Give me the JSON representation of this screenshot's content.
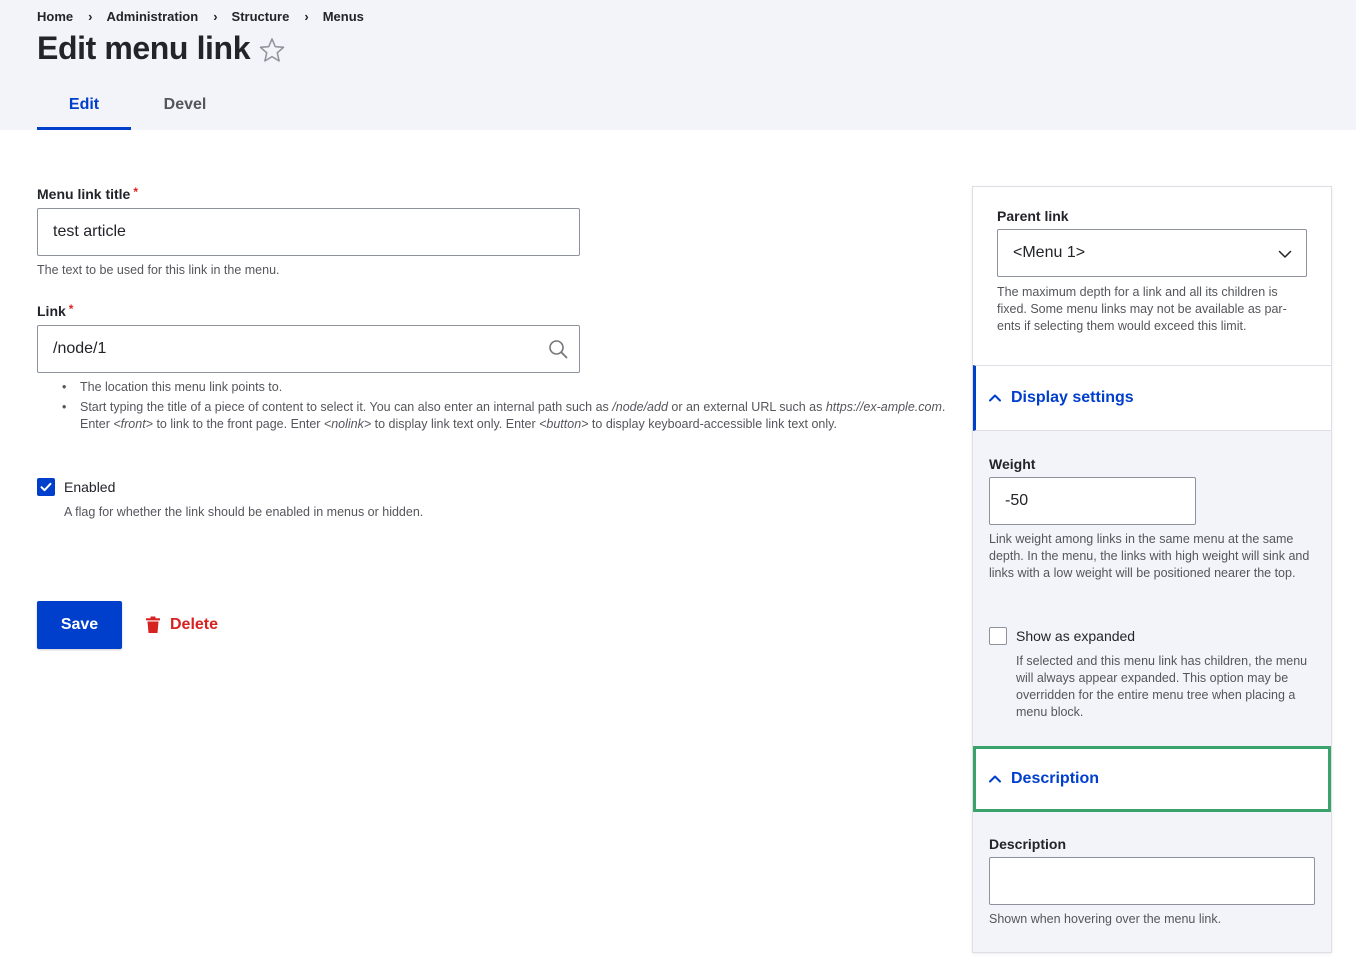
{
  "breadcrumb": [
    "Home",
    "Administration",
    "Structure",
    "Menus"
  ],
  "page_title": "Edit menu link",
  "tabs": [
    {
      "label": "Edit",
      "active": true
    },
    {
      "label": "Devel",
      "active": false
    }
  ],
  "form": {
    "title_label": "Menu link title",
    "title_value": "test article",
    "title_description": "The text to be used for this link in the menu.",
    "link_label": "Link",
    "link_value": "/node/1",
    "link_help": {
      "item1": "The location this menu link points to.",
      "item2_a": "Start typing the title of a piece of content to select it. You can also enter an internal path such as ",
      "item2_b": "/node/add",
      "item2_c": " or an external URL such as ",
      "item2_d": "https://ex-ample.com",
      "item2_e": ". Enter ",
      "item2_f": "<front>",
      "item2_g": " to link to the front page. Enter ",
      "item2_h": "<nolink>",
      "item2_i": " to display link text only. Enter ",
      "item2_j": "<button>",
      "item2_k": " to display keyboard-accessible link text only."
    },
    "enabled_label": "Enabled",
    "enabled_checked": true,
    "enabled_description": "A flag for whether the link should be enabled in menus or hidden.",
    "required_mark": "*"
  },
  "actions": {
    "save_label": "Save",
    "delete_label": "Delete"
  },
  "sidebar": {
    "parent_label": "Parent link",
    "parent_value": "<Menu 1>",
    "parent_description": "The maximum depth for a link and all its children is fixed. Some menu links may not be available as par-ents if selecting them would exceed this limit.",
    "display_settings_label": "Display settings",
    "weight_label": "Weight",
    "weight_value": "-50",
    "weight_description": "Link weight among links in the same menu at the same depth. In the menu, the links with high weight will sink and links with a low weight will be positioned nearer the top.",
    "expanded_label": "Show as expanded",
    "expanded_checked": false,
    "expanded_description": "If selected and this menu link has children, the menu will always appear expanded. This option may be overridden for the entire menu tree when placing a menu block.",
    "description_section_label": "Description",
    "description_label": "Description",
    "description_value": "",
    "description_help": "Shown when hovering over the menu link."
  },
  "colors": {
    "accent": "#003ecc",
    "danger": "#d72222",
    "focus": "#3aa36b",
    "header_bg": "#f3f4f9"
  },
  "icons": [
    "star-icon",
    "search-icon",
    "chevron-down-icon",
    "chevron-up-icon",
    "trash-icon",
    "check-icon"
  ]
}
